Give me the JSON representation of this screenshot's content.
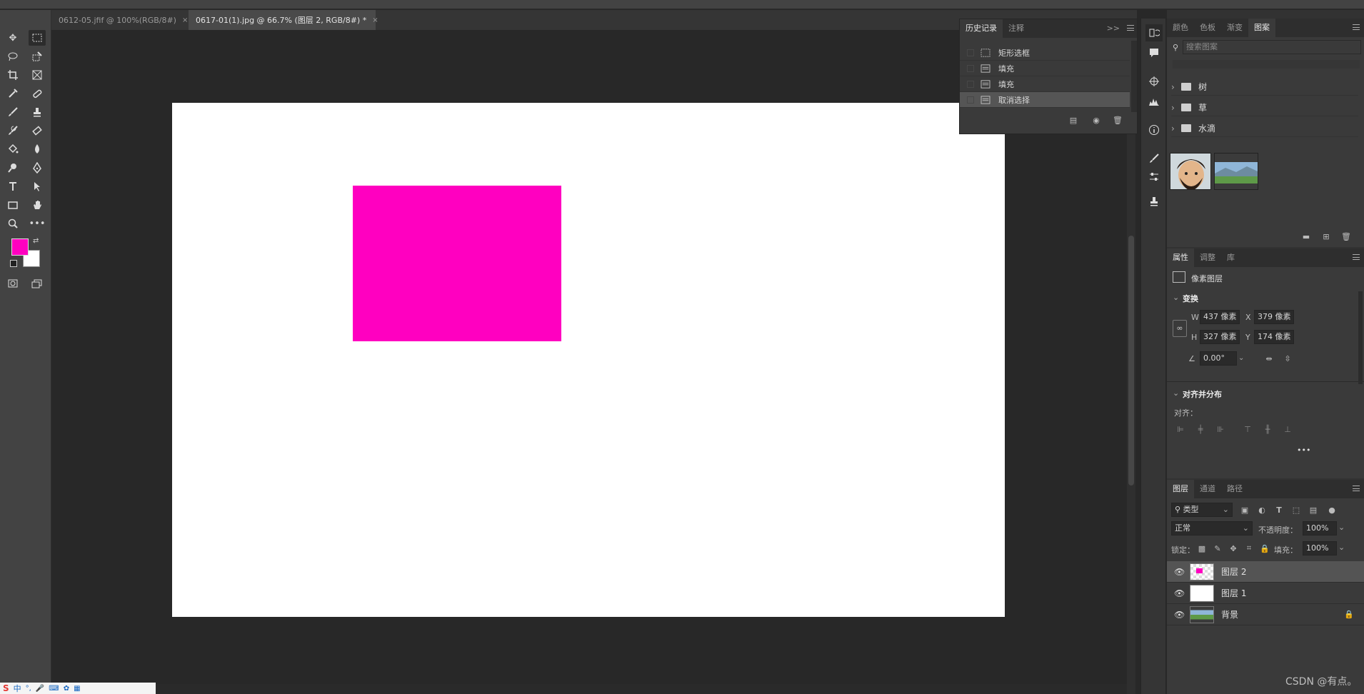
{
  "document_tabs": [
    {
      "label": "0612-05.jfif @ 100%(RGB/8#)",
      "close": "×"
    },
    {
      "label": "0617-01(1).jpg @ 66.7% (图层 2, RGB/8#) *",
      "close": "×"
    }
  ],
  "canvas": {
    "rect_color": "#ff00c0",
    "background": "#ffffff"
  },
  "colors": {
    "foreground": "#ff00c0",
    "background": "#ffffff"
  },
  "history_panel": {
    "tabs": [
      "历史记录",
      "注释"
    ],
    "expand": ">>",
    "items": [
      "矩形选框",
      "填充",
      "填充",
      "取消选择"
    ]
  },
  "patterns_panel": {
    "tabs": [
      "颜色",
      "色板",
      "渐变",
      "图案"
    ],
    "search_placeholder": "搜索图案",
    "folders": [
      "树",
      "草",
      "水滴"
    ]
  },
  "properties_panel": {
    "tabs": [
      "属性",
      "调整",
      "库"
    ],
    "layer_type": "像素图层",
    "transform_title": "变换",
    "w_label": "W",
    "w_value": "437 像素",
    "x_label": "X",
    "x_value": "379 像素",
    "h_label": "H",
    "h_value": "327 像素",
    "y_label": "Y",
    "y_value": "174 像素",
    "angle_value": "0.00°",
    "align_title": "对齐并分布",
    "align_label": "对齐：",
    "more": "•••"
  },
  "layers_panel": {
    "tabs": [
      "图层",
      "通道",
      "路径"
    ],
    "filter_kind": "类型",
    "blend_mode": "正常",
    "opacity_label": "不透明度：",
    "opacity_value": "100%",
    "lock_label": "锁定：",
    "fill_label": "填充：",
    "fill_value": "100%",
    "layers": [
      {
        "name": "图层 2",
        "selected": true
      },
      {
        "name": "图层 1",
        "selected": false
      },
      {
        "name": "背景",
        "selected": false,
        "locked": true
      }
    ]
  },
  "taskbar": {
    "ime_label": "中"
  },
  "watermark": "CSDN @有点。"
}
